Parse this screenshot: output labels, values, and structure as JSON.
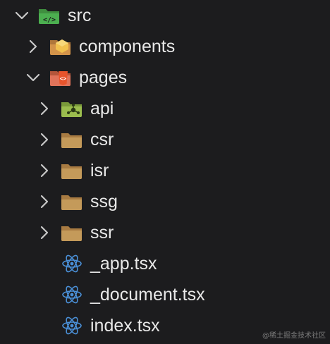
{
  "explorer": {
    "items": [
      {
        "label": "src",
        "kind": "folder",
        "icon": "src-folder-icon",
        "expanded": true
      },
      {
        "label": "components",
        "kind": "folder",
        "icon": "components-folder-icon",
        "expanded": false
      },
      {
        "label": "pages",
        "kind": "folder",
        "icon": "pages-folder-icon",
        "expanded": true
      },
      {
        "label": "api",
        "kind": "folder",
        "icon": "api-folder-icon",
        "expanded": false
      },
      {
        "label": "csr",
        "kind": "folder",
        "icon": "folder-icon",
        "expanded": false
      },
      {
        "label": "isr",
        "kind": "folder",
        "icon": "folder-icon",
        "expanded": false
      },
      {
        "label": "ssg",
        "kind": "folder",
        "icon": "folder-icon",
        "expanded": false
      },
      {
        "label": "ssr",
        "kind": "folder",
        "icon": "folder-icon",
        "expanded": false
      },
      {
        "label": "_app.tsx",
        "kind": "file",
        "icon": "react-icon"
      },
      {
        "label": "_document.tsx",
        "kind": "file",
        "icon": "react-icon"
      },
      {
        "label": "index.tsx",
        "kind": "file",
        "icon": "react-icon"
      }
    ]
  },
  "colors": {
    "background": "#1c1c1e",
    "text": "#e8e8e8",
    "chevron": "#c8c8c8",
    "folder": "#c49a5a",
    "react": "#4a8fd6"
  },
  "watermark": "@稀土掘金技术社区"
}
